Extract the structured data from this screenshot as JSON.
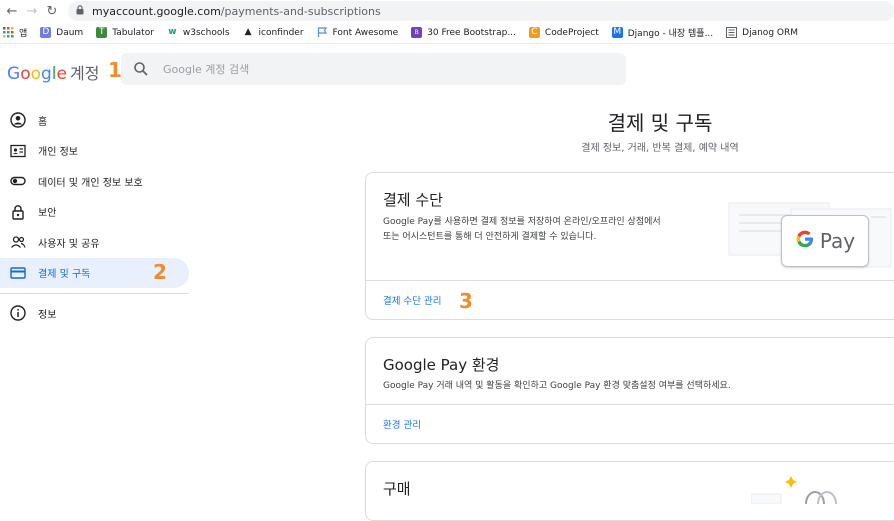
{
  "browser": {
    "url_host": "myaccount.google.com",
    "url_path": "/payments-and-subscriptions",
    "bookmarks": [
      {
        "label": "앱",
        "icon": "apps-grid-icon",
        "color": "#4285f4"
      },
      {
        "label": "Daum",
        "icon": "daum-icon",
        "color": "#6f7ce8"
      },
      {
        "label": "Tabulator",
        "icon": "tabulator-icon",
        "color": "#3c8a3e"
      },
      {
        "label": "w3schools",
        "icon": "w3schools-icon",
        "color": "#04aa6d"
      },
      {
        "label": "iconfinder",
        "icon": "iconfinder-icon",
        "color": "#202124"
      },
      {
        "label": "Font Awesome",
        "icon": "flag-icon",
        "color": "#528dd7"
      },
      {
        "label": "30 Free Bootstrap...",
        "icon": "bootstrap-icon",
        "color": "#6f42c1"
      },
      {
        "label": "CodeProject",
        "icon": "codeproject-icon",
        "color": "#f29a1a"
      },
      {
        "label": "Django - 내장 템플...",
        "icon": "django-icon",
        "color": "#1a73e8"
      },
      {
        "label": "Djanog ORM",
        "icon": "document-icon",
        "color": "#5f6368"
      }
    ]
  },
  "header": {
    "logo_letters": [
      "G",
      "o",
      "o",
      "g",
      "l",
      "e"
    ],
    "account_label": "계정",
    "search_placeholder": "Google 계정 검색"
  },
  "annotations": {
    "one": "1",
    "two": "2",
    "three": "3"
  },
  "sidebar": {
    "items": [
      {
        "label": "홈",
        "icon": "account-circle-icon"
      },
      {
        "label": "개인 정보",
        "icon": "id-card-icon"
      },
      {
        "label": "데이터 및 개인 정보 보호",
        "icon": "toggle-icon"
      },
      {
        "label": "보안",
        "icon": "lock-icon"
      },
      {
        "label": "사용자 및 공유",
        "icon": "people-icon"
      },
      {
        "label": "결제 및 구독",
        "icon": "credit-card-icon",
        "active": true
      },
      {
        "label": "정보",
        "icon": "info-icon"
      }
    ]
  },
  "main": {
    "title": "결제 및 구독",
    "subtitle": "결제 정보, 거래, 반복 결제, 예약 내역",
    "cards": [
      {
        "title": "결제 수단",
        "description_line1": "Google Pay를 사용하면 결제 정보를 저장하여 온라인/오프라인 상점에서",
        "description_line2": "또는 어시스턴트를 통해 더 안전하게 결제할 수 있습니다.",
        "link": "결제 수단 관리",
        "gpay_label": "Pay"
      },
      {
        "title": "Google Pay 환경",
        "description": "Google Pay 거래 내역 및 활동을 확인하고 Google Pay 환경 맞춤설정 여부를 선택하세요.",
        "link": "환경 관리"
      },
      {
        "title": "구매"
      }
    ]
  },
  "colors": {
    "accent_blue": "#1a73e8",
    "active_bg": "#e8f0fe",
    "annotation_orange": "#f28a2e"
  }
}
